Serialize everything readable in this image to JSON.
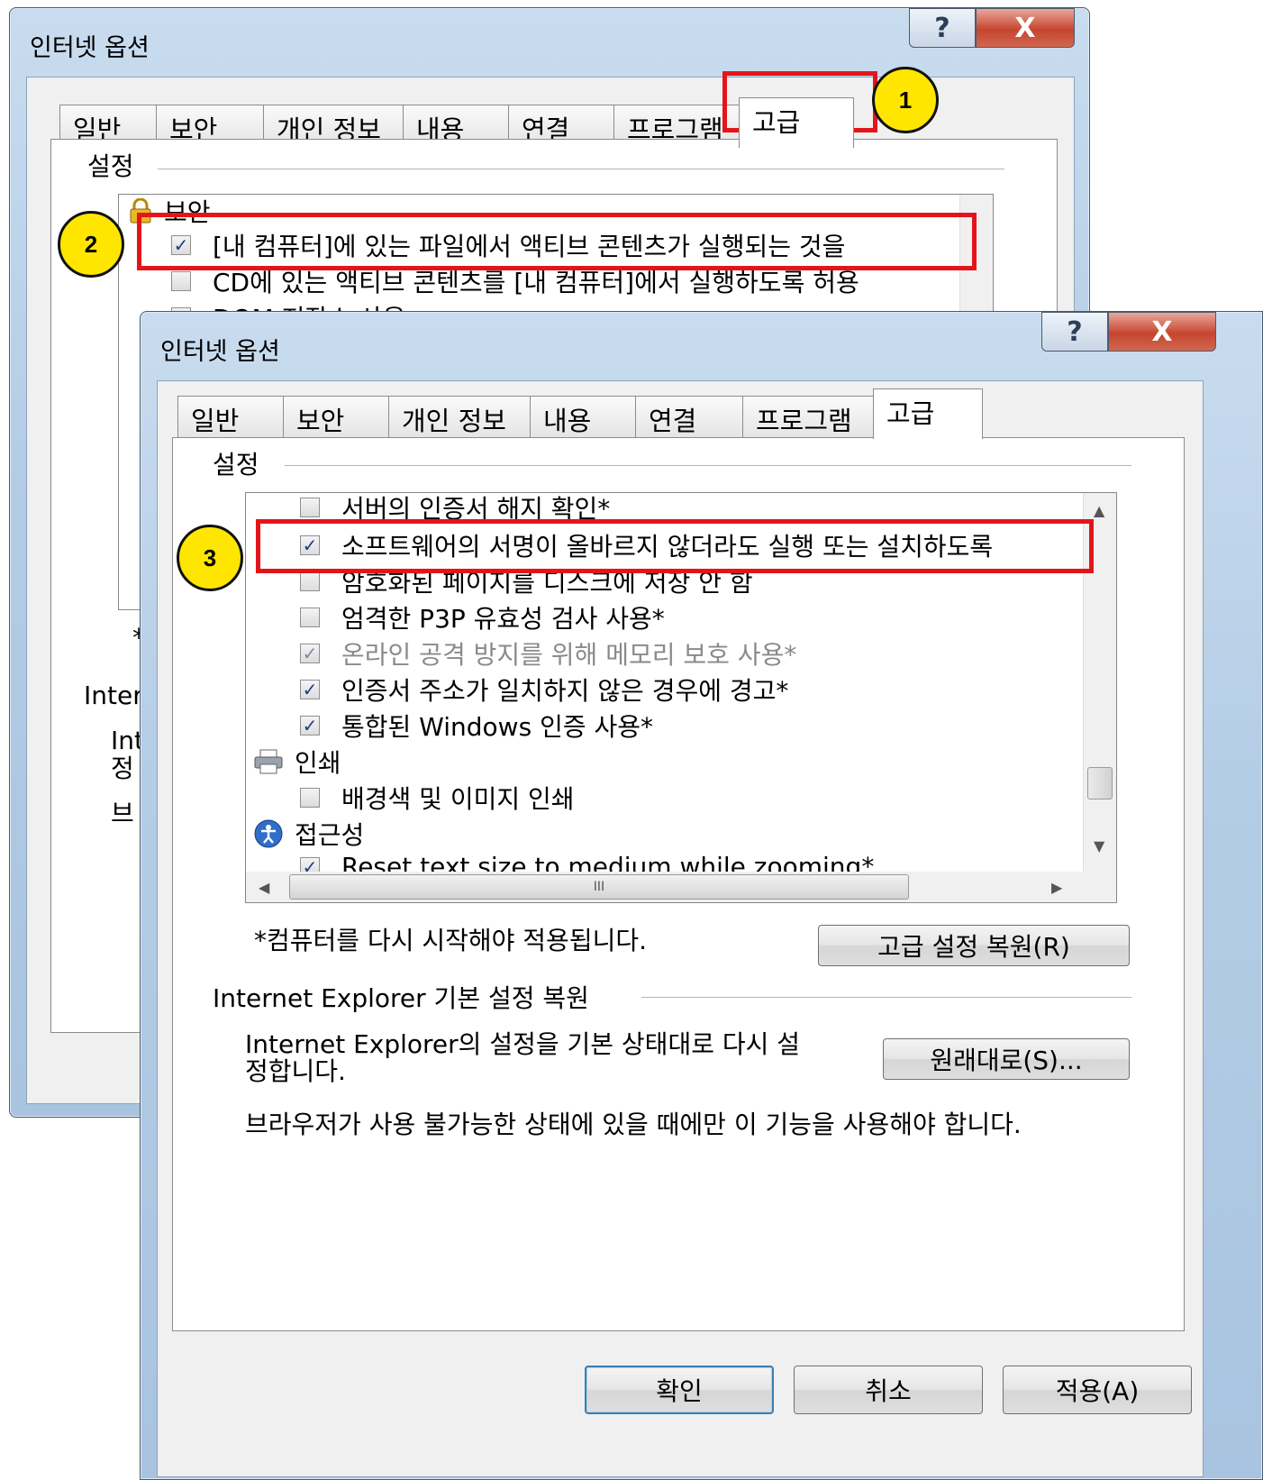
{
  "dialog_title": "인터넷 옵션",
  "tabs": [
    "일반",
    "보안",
    "개인 정보",
    "내용",
    "연결",
    "프로그램",
    "고급"
  ],
  "group_settings": "설정",
  "back": {
    "items": [
      {
        "label": "보안",
        "icon": "lock-icon"
      },
      {
        "label": "[내 컴퓨터]에 있는 파일에서 액티브 콘텐츠가 실행되는 것을 ",
        "checked": true
      },
      {
        "label": "CD에 있는 액티브 콘텐츠를 [내 컴퓨터]에서 실행하도록 허용",
        "checked": false
      },
      {
        "label": "DOM 저장소 사용",
        "checked": true
      }
    ],
    "fragments": {
      "star": "*",
      "inter": "Inter",
      "int": "Int",
      "jeong": "정",
      "beu": "브"
    }
  },
  "front": {
    "items": [
      {
        "label": "서버의 인증서 해지 확인*",
        "checked": false
      },
      {
        "label": "소프트웨어의 서명이 올바르지 않더라도 실행 또는 설치하도록",
        "checked": true
      },
      {
        "label": "암호화된 페이지를 디스크에 저장 안 함",
        "checked": false
      },
      {
        "label": "엄격한 P3P 유효성 검사 사용*",
        "checked": false
      },
      {
        "label": "온라인 공격 방지를 위해 메모리 보호 사용*",
        "checked": true,
        "disabled": true
      },
      {
        "label": "인증서 주소가 일치하지 않은 경우에 경고*",
        "checked": true
      },
      {
        "label": "통합된 Windows 인증 사용*",
        "checked": true
      },
      {
        "label": "인쇄",
        "icon": "printer-icon"
      },
      {
        "label": "배경색 및 이미지 인쇄",
        "checked": false
      },
      {
        "label": "접근성",
        "icon": "accessibility-icon"
      },
      {
        "label": "Reset text size to medium while zooming*",
        "checked": true
      }
    ],
    "restart_note": "*컴퓨터를 다시 시작해야 적용됩니다.",
    "restore_advanced_button": "고급 설정 복원(R)",
    "reset_group": "Internet Explorer 기본 설정 복원",
    "reset_desc_1": "Internet Explorer의 설정을 기본 상태대로 다시 설",
    "reset_desc_2": "정합니다.",
    "reset_button": "원래대로(S)...",
    "reset_warning": "브라우저가 사용 불가능한 상태에 있을 때에만 이 기능을 사용해야 합니다.",
    "hscroll_thumb": "III",
    "ok_button": "확인",
    "cancel_button": "취소",
    "apply_button": "적용(A)"
  },
  "caption": {
    "help": "?",
    "close": "X"
  },
  "badges": [
    "1",
    "2",
    "3"
  ],
  "highlight_color": "#e3151a",
  "badge_color": "#ffe600"
}
